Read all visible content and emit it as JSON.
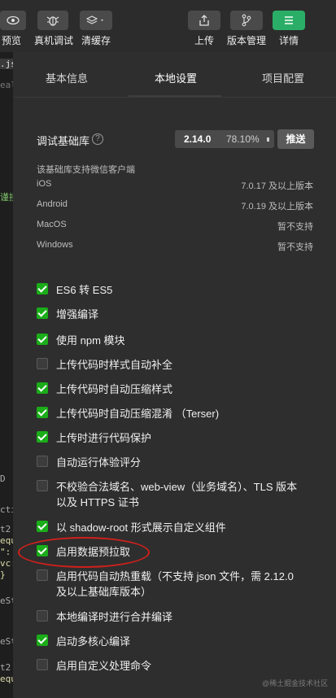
{
  "toolbar": {
    "buttons": [
      {
        "label": "预览",
        "icon": "eye-icon"
      },
      {
        "label": "真机调试",
        "icon": "bug-icon"
      },
      {
        "label": "清缓存",
        "icon": "layers-icon"
      },
      {
        "label": "上传",
        "icon": "upload-icon"
      },
      {
        "label": "版本管理",
        "icon": "branch-icon"
      },
      {
        "label": "详情",
        "icon": "menu-icon"
      }
    ]
  },
  "left_strip": {
    "fragments": [
      ".js",
      "eal",
      "谨接",
      "D",
      "cti",
      "t2",
      "equ",
      "\":",
      "vc:",
      "}",
      "eSt",
      "eSt",
      "t2",
      "equ"
    ]
  },
  "tabs": [
    {
      "label": "基本信息"
    },
    {
      "label": "本地设置"
    },
    {
      "label": "项目配置"
    }
  ],
  "base_lib": {
    "label": "调试基础库",
    "version": "2.14.0",
    "percent": "78.10%",
    "push_label": "推送"
  },
  "support_note": "该基础库支持微信客户端",
  "os_support": [
    {
      "os": "iOS",
      "version": "7.0.17 及以上版本"
    },
    {
      "os": "Android",
      "version": "7.0.19 及以上版本"
    },
    {
      "os": "MacOS",
      "version": "暂不支持"
    },
    {
      "os": "Windows",
      "version": "暂不支持"
    }
  ],
  "options": [
    {
      "label": "ES6 转 ES5",
      "checked": true
    },
    {
      "label": "增强编译",
      "checked": true
    },
    {
      "label": "使用 npm 模块",
      "checked": true
    },
    {
      "label": "上传代码时样式自动补全",
      "checked": false
    },
    {
      "label": "上传代码时自动压缩样式",
      "checked": true
    },
    {
      "label": "上传代码时自动压缩混淆 （Terser)",
      "checked": true
    },
    {
      "label": "上传时进行代码保护",
      "checked": true
    },
    {
      "label": "自动运行体验评分",
      "checked": false
    },
    {
      "label": "不校验合法域名、web-view（业务域名）、TLS 版本以及 HTTPS 证书",
      "checked": false
    },
    {
      "label": "以 shadow-root 形式展示自定义组件",
      "checked": true
    },
    {
      "label": "启用数据预拉取",
      "checked": true
    },
    {
      "label": "启用代码自动热重载（不支持 json 文件，需 2.12.0 及以上基础库版本）",
      "checked": false
    },
    {
      "label": "本地编译时进行合并编译",
      "checked": false
    },
    {
      "label": "启动多核心编译",
      "checked": true
    },
    {
      "label": "启用自定义处理命令",
      "checked": false
    }
  ],
  "watermark": "@稀土掘金技术社区",
  "colors": {
    "accent": "#1aad19",
    "annotation": "#d0201b",
    "panel_bg": "#2e2e2e"
  }
}
